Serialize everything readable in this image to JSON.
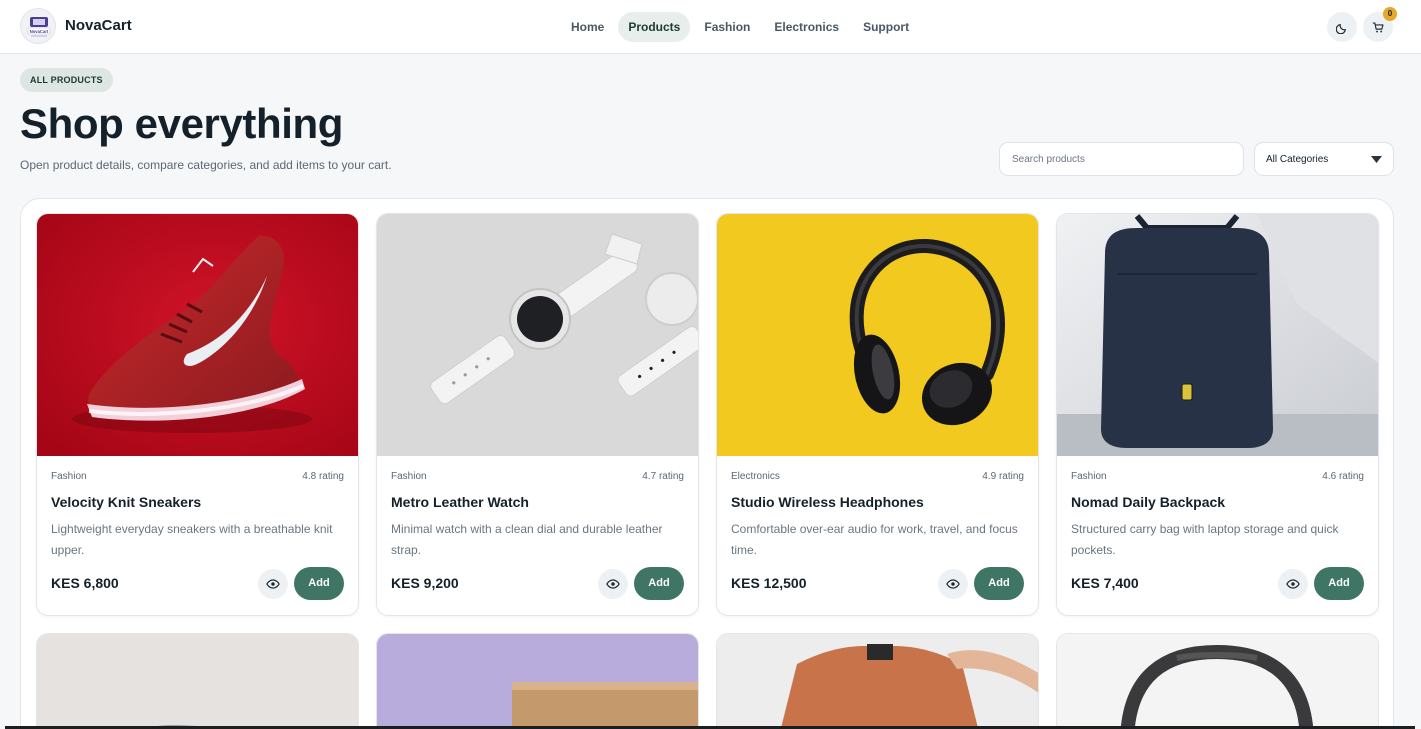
{
  "header": {
    "brand": "NovaCart",
    "logo_text": "NovaCart",
    "nav": [
      {
        "label": "Home",
        "active": false
      },
      {
        "label": "Products",
        "active": true
      },
      {
        "label": "Fashion",
        "active": false
      },
      {
        "label": "Electronics",
        "active": false
      },
      {
        "label": "Support",
        "active": false
      }
    ],
    "cart_count": "0",
    "theme_icon": "moon-icon",
    "cart_icon": "cart-icon"
  },
  "hero": {
    "chip": "ALL PRODUCTS",
    "title": "Shop everything",
    "subtitle": "Open product details, compare categories, and add items to your cart."
  },
  "filters": {
    "search_placeholder": "Search products",
    "category_selected": "All Categories"
  },
  "products": [
    {
      "category": "Fashion",
      "rating": "4.8 rating",
      "name": "Velocity Knit Sneakers",
      "description": "Lightweight everyday sneakers with a breathable knit upper.",
      "price": "KES 6,800",
      "add_label": "Add"
    },
    {
      "category": "Fashion",
      "rating": "4.7 rating",
      "name": "Metro Leather Watch",
      "description": "Minimal watch with a clean dial and durable leather strap.",
      "price": "KES 9,200",
      "add_label": "Add"
    },
    {
      "category": "Electronics",
      "rating": "4.9 rating",
      "name": "Studio Wireless Headphones",
      "description": "Comfortable over-ear audio for work, travel, and focus time.",
      "price": "KES 12,500",
      "add_label": "Add"
    },
    {
      "category": "Fashion",
      "rating": "4.6 rating",
      "name": "Nomad Daily Backpack",
      "description": "Structured carry bag with laptop storage and quick pockets.",
      "price": "KES 7,400",
      "add_label": "Add"
    }
  ],
  "colors": {
    "accent": "#3f7565",
    "badge": "#e4a82a",
    "background": "#f5f7f9"
  }
}
